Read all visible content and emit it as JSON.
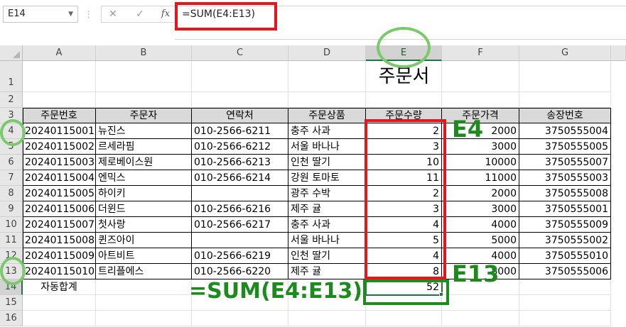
{
  "name_box": {
    "value": "E14"
  },
  "formula_bar": {
    "cancel_icon": "✕",
    "enter_icon": "✓",
    "fx_label": "fx",
    "formula": "=SUM(E4:E13)"
  },
  "columns": [
    "A",
    "B",
    "C",
    "D",
    "E",
    "F",
    "G"
  ],
  "rows": [
    "1",
    "2",
    "3",
    "4",
    "5",
    "6",
    "7",
    "8",
    "9",
    "10",
    "11",
    "12",
    "13",
    "14",
    "15",
    "16"
  ],
  "sheet": {
    "title": "주문서",
    "headers": [
      "주문번호",
      "주문자",
      "연락처",
      "주문상품",
      "주문수량",
      "주문가격",
      "송장번호"
    ],
    "records": [
      [
        "20240115001",
        "뉴진스",
        "010-2566-6211",
        "충주 사과",
        "2",
        "2000",
        "3750555004"
      ],
      [
        "20240115002",
        "르세라핌",
        "010-2566-6212",
        "서울 바나나",
        "3",
        "3000",
        "3750555005"
      ],
      [
        "20240115003",
        "제로베이스원",
        "010-2566-6213",
        "인천 딸기",
        "10",
        "10000",
        "3750555007"
      ],
      [
        "20240115004",
        "엔믹스",
        "010-2566-6214",
        "강원 토마토",
        "11",
        "11000",
        "3750555003"
      ],
      [
        "20240115005",
        "하이키",
        "",
        "광주 수박",
        "2",
        "2000",
        "3750555008"
      ],
      [
        "20240115006",
        "더윈드",
        "010-2566-6216",
        "제주 귤",
        "3",
        "3000",
        "3750555001"
      ],
      [
        "20240115007",
        "첫사랑",
        "010-2566-6217",
        "충주 사과",
        "4",
        "4000",
        "3750555009"
      ],
      [
        "20240115008",
        "퀸즈아이",
        "",
        "서울 바나나",
        "5",
        "5000",
        "3750555002"
      ],
      [
        "20240115009",
        "아트비트",
        "010-2566-6219",
        "인천 딸기",
        "4",
        "4000",
        "3750555010"
      ],
      [
        "20240115010",
        "트리플에스",
        "010-2566-6220",
        "제주 귤",
        "8",
        "8000",
        "3750555006"
      ]
    ],
    "total_label": "자동합계",
    "total_value": "52"
  },
  "annotations": {
    "label_e4": "E4",
    "label_e13": "E13",
    "label_sum": "=SUM(E4:E13)",
    "ring_color": "#7ac96b",
    "red_color": "#e8131b",
    "green_color": "#1f8c1f"
  }
}
